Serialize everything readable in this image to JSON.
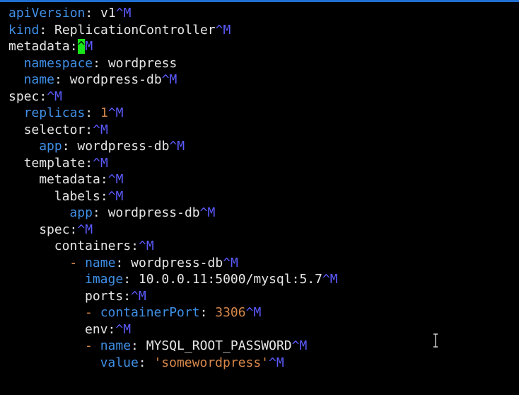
{
  "editor": {
    "line_ending_marker": "^M",
    "lines": [
      {
        "indent": 0,
        "dash": "",
        "key": "apiVersion",
        "key_style": "blue",
        "colon": ":",
        "value": " v1",
        "value_style": "white",
        "cr": "^M",
        "cursor": false
      },
      {
        "indent": 0,
        "dash": "",
        "key": "kind",
        "key_style": "blue",
        "colon": ":",
        "value": " ReplicationController",
        "value_style": "white",
        "cr": "^M",
        "cursor": false
      },
      {
        "indent": 0,
        "dash": "",
        "key": "metadata",
        "key_style": "white",
        "colon": ":",
        "value": "",
        "value_style": "white",
        "cr": "^M",
        "cursor": true
      },
      {
        "indent": 2,
        "dash": "",
        "key": "namespace",
        "key_style": "blue",
        "colon": ":",
        "value": " wordpress",
        "value_style": "white",
        "cr": "",
        "cursor": false
      },
      {
        "indent": 2,
        "dash": "",
        "key": "name",
        "key_style": "blue",
        "colon": ":",
        "value": " wordpress-db",
        "value_style": "white",
        "cr": "^M",
        "cursor": false
      },
      {
        "indent": 0,
        "dash": "",
        "key": "spec",
        "key_style": "white",
        "colon": ":",
        "value": "",
        "value_style": "white",
        "cr": "^M",
        "cursor": false
      },
      {
        "indent": 2,
        "dash": "",
        "key": "replicas",
        "key_style": "blue",
        "colon": ":",
        "value": " 1",
        "value_style": "num",
        "cr": "^M",
        "cursor": false
      },
      {
        "indent": 2,
        "dash": "",
        "key": "selector",
        "key_style": "white",
        "colon": ":",
        "value": "",
        "value_style": "white",
        "cr": "^M",
        "cursor": false
      },
      {
        "indent": 4,
        "dash": "",
        "key": "app",
        "key_style": "blue",
        "colon": ":",
        "value": " wordpress-db",
        "value_style": "white",
        "cr": "^M",
        "cursor": false
      },
      {
        "indent": 2,
        "dash": "",
        "key": "template",
        "key_style": "white",
        "colon": ":",
        "value": "",
        "value_style": "white",
        "cr": "^M",
        "cursor": false
      },
      {
        "indent": 4,
        "dash": "",
        "key": "metadata",
        "key_style": "white",
        "colon": ":",
        "value": "",
        "value_style": "white",
        "cr": "^M",
        "cursor": false
      },
      {
        "indent": 6,
        "dash": "",
        "key": "labels",
        "key_style": "white",
        "colon": ":",
        "value": "",
        "value_style": "white",
        "cr": "^M",
        "cursor": false
      },
      {
        "indent": 8,
        "dash": "",
        "key": "app",
        "key_style": "blue",
        "colon": ":",
        "value": " wordpress-db",
        "value_style": "white",
        "cr": "^M",
        "cursor": false
      },
      {
        "indent": 4,
        "dash": "",
        "key": "spec",
        "key_style": "white",
        "colon": ":",
        "value": "",
        "value_style": "white",
        "cr": "^M",
        "cursor": false
      },
      {
        "indent": 6,
        "dash": "",
        "key": "containers",
        "key_style": "white",
        "colon": ":",
        "value": "",
        "value_style": "white",
        "cr": "^M",
        "cursor": false
      },
      {
        "indent": 8,
        "dash": "- ",
        "key": "name",
        "key_style": "blue",
        "colon": ":",
        "value": " wordpress-db",
        "value_style": "white",
        "cr": "^M",
        "cursor": false
      },
      {
        "indent": 10,
        "dash": "",
        "key": "image",
        "key_style": "blue",
        "colon": ":",
        "value": " 10.0.0.11:5000/mysql:5.7",
        "value_style": "white",
        "cr": "^M",
        "cursor": false
      },
      {
        "indent": 10,
        "dash": "",
        "key": "ports",
        "key_style": "white",
        "colon": ":",
        "value": "",
        "value_style": "white",
        "cr": "^M",
        "cursor": false
      },
      {
        "indent": 10,
        "dash": "- ",
        "key": "containerPort",
        "key_style": "blue",
        "colon": ":",
        "value": " 3306",
        "value_style": "num",
        "cr": "^M",
        "cursor": false
      },
      {
        "indent": 10,
        "dash": "",
        "key": "env",
        "key_style": "white",
        "colon": ":",
        "value": "",
        "value_style": "white",
        "cr": "^M",
        "cursor": false
      },
      {
        "indent": 10,
        "dash": "- ",
        "key": "name",
        "key_style": "blue",
        "colon": ":",
        "value": " MYSQL_ROOT_PASSWORD",
        "value_style": "white",
        "cr": "^M",
        "cursor": false
      },
      {
        "indent": 12,
        "dash": "",
        "key": "value",
        "key_style": "blue",
        "colon": ":",
        "value": " 'somewordpress'",
        "value_style": "str",
        "cr": "^M",
        "cursor": false
      }
    ]
  },
  "colors": {
    "background": "#000000",
    "key_blue": "#3f8fe6",
    "value_orange": "#d7884a",
    "carriage_return": "#5b5bff",
    "cursor": "#19e619",
    "top_rule": "#1f6fd0"
  },
  "icons": {
    "mouse_pointer": "text-ibeam-cursor-icon"
  }
}
